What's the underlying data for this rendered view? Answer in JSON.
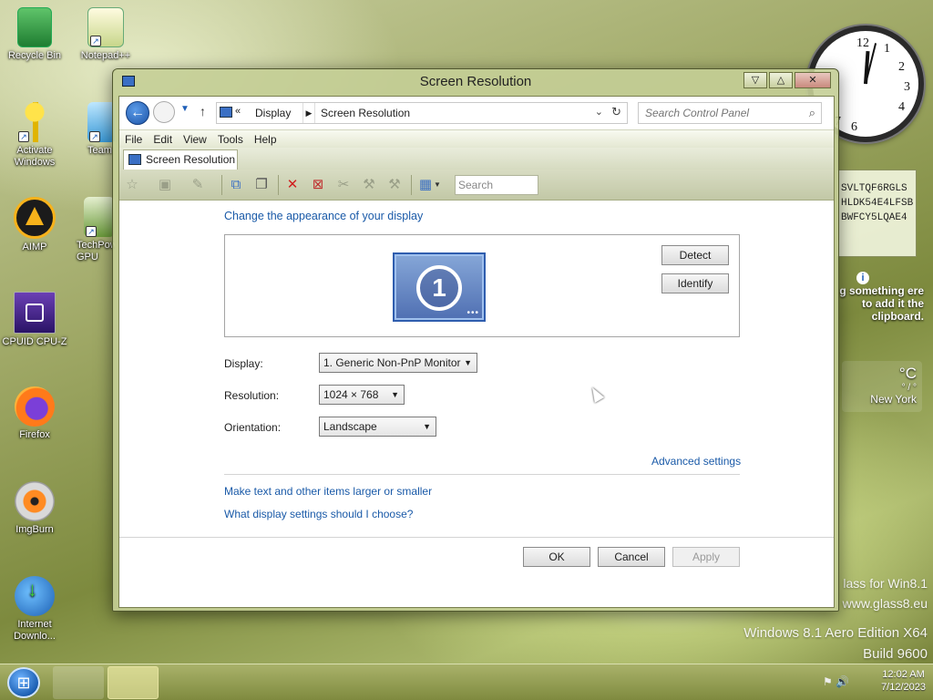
{
  "desktop": {
    "icons": [
      {
        "label": "Recycle Bin",
        "icon": "recycle-bin-icon"
      },
      {
        "label": "Notepad++",
        "icon": "notepadpp-icon"
      },
      {
        "label": "Activate Windows",
        "icon": "key-icon"
      },
      {
        "label": "Team",
        "icon": "teamviewer-icon"
      },
      {
        "label": "AIMP",
        "icon": "aimp-icon"
      },
      {
        "label": "TechPow GPU",
        "icon": "gpu-z-icon"
      },
      {
        "label": "CPUID CPU-Z",
        "icon": "cpu-z-icon"
      },
      {
        "label": "Firefox",
        "icon": "firefox-icon"
      },
      {
        "label": "ImgBurn",
        "icon": "imgburn-icon"
      },
      {
        "label": "Internet Downlo...",
        "icon": "idm-icon"
      }
    ],
    "clipboard_lines": [
      "SVLTQF6RGLS",
      "HLDK54E4LFSB",
      "BWFCY5LQAE4"
    ],
    "clipboard_info": "g something ere to add it the clipboard.",
    "weather": {
      "temp": "°C",
      "range": "° / °",
      "city": "New York"
    },
    "watermark": {
      "line1": "lass for Win8.1",
      "line2": "www.glass8.eu",
      "line3": "Windows 8.1 Aero Edition X64",
      "line4": "Build 9600"
    }
  },
  "taskbar": {
    "time": "12:02 AM",
    "date": "7/12/2023"
  },
  "window": {
    "title": "Screen Resolution",
    "caption": {
      "minimize": "▽",
      "maximize": "△",
      "close": "✕"
    },
    "address": {
      "crumbs": [
        "Display",
        "Screen Resolution"
      ],
      "search_placeholder": "Search Control Panel"
    },
    "menu": [
      "File",
      "Edit",
      "View",
      "Tools",
      "Help"
    ],
    "tab_label": "Screen Resolution",
    "toolbar_search_placeholder": "Search",
    "content": {
      "heading": "Change the appearance of your display",
      "monitor_number": "1",
      "detect_label": "Detect",
      "identify_label": "Identify",
      "display_label": "Display:",
      "display_value": "1. Generic Non-PnP Monitor",
      "resolution_label": "Resolution:",
      "resolution_value": "1024 × 768",
      "orientation_label": "Orientation:",
      "orientation_value": "Landscape",
      "advanced_link": "Advanced settings",
      "link_text_size": "Make text and other items larger or smaller",
      "link_which": "What display settings should I choose?",
      "ok_label": "OK",
      "cancel_label": "Cancel",
      "apply_label": "Apply"
    }
  },
  "colors": {
    "link": "#1a5aa8",
    "accent_blue": "#1d55a8",
    "desktop_green": "#9fa866"
  }
}
